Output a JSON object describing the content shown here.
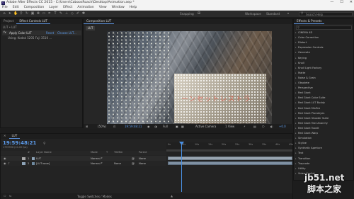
{
  "app": {
    "title": "Adobe After Effects CC 2015 - C:\\Users\\CaboosRoach\\Desktop\\Animation.aep *",
    "logo_text": "Ae",
    "window_buttons": [
      "—",
      "☐",
      "✕"
    ]
  },
  "menu": [
    "File",
    "Edit",
    "Composition",
    "Layer",
    "Effect",
    "Animation",
    "View",
    "Window",
    "Help"
  ],
  "toolbar": {
    "snapping_label": "Snapping",
    "workspace_label": "Workspace",
    "workspace_value": "Standard",
    "search_placeholder": "Search Help"
  },
  "project_panel": {
    "tabs": [
      "Project",
      "Effect Controls LUT"
    ],
    "comp_path": "LUT • LUT",
    "effect_name": "Apply Color LUT",
    "reset_label": "Reset",
    "choose_label": "Choose LUT...",
    "lut_file": "Using: Kodak 5205 Fuji 3510 ..."
  },
  "composition_panel": {
    "tab": "Composition LUT",
    "comp_tab": "LUT",
    "viewer_bar": {
      "zoom": "(50%)",
      "timecode": "19:59:48:21",
      "resolution": "Full",
      "camera": "Active Camera",
      "views": "1 View",
      "exposure": "+0.0"
    }
  },
  "effects_panel": {
    "title": "Effects & Presets",
    "search_placeholder": "",
    "items": [
      "CINEMA 4D",
      "Color Correction",
      "Distort",
      "Expression Controls",
      "Generate",
      "Keying",
      "Knoll",
      "Knoll Light Factory",
      "Matte",
      "Noise & Grain",
      "Obsolete",
      "Perspective",
      "Red Giant",
      "Red Giant Color Suite",
      "Red Giant LUT Buddy",
      "Red Giant MisFire",
      "Red Giant Pluraleyes",
      "Red Giant Shooter Suite",
      "Red Giant Text Anarchy",
      "Red Giant ToonIt",
      "Red Giant Warp",
      "Simulation",
      "Stylize",
      "Synthetic Aperture",
      "Text",
      "Transition",
      "Trapcode",
      "Utility",
      "Video Copilot"
    ]
  },
  "timeline": {
    "tab": "LUT",
    "timecode": "19:59:48:21",
    "frame_info": "1799996 (24.00 fps)",
    "columns": [
      "#",
      "Layer Name",
      "Mode",
      "T",
      "TrkMat",
      "Parent"
    ],
    "layers": [
      {
        "num": "1",
        "name": "LUT",
        "mode": "Normal",
        "trkmat": "",
        "parent": "None"
      },
      {
        "num": "2",
        "name": "[LUT.wow]",
        "mode": "Normal",
        "trkmat": "None",
        "parent": "None"
      }
    ],
    "ruler": [
      "0s",
      "05s",
      "10s",
      "15s",
      "20s",
      "25s",
      "30s",
      "35s",
      "40s",
      "45s"
    ],
    "footer_label": "Toggle Switches / Modes"
  },
  "watermark": {
    "url": "jb51.net",
    "text": "脚本之家"
  },
  "colors": {
    "accent_blue": "#5a8fd8",
    "timecode_blue": "#5d9cec",
    "playhead": "#4a90e2",
    "layer_bar": "#8ea4b8"
  }
}
